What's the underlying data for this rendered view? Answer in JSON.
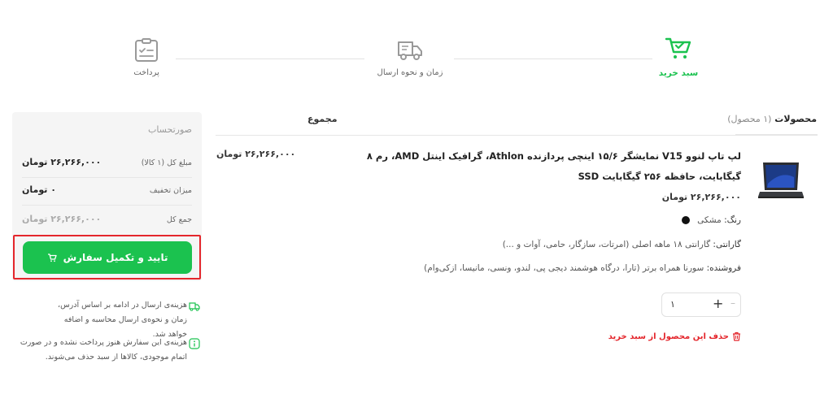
{
  "stepper": {
    "steps": [
      {
        "label": "سبد خرید",
        "icon": "cart-check-icon",
        "active": true
      },
      {
        "label": "زمان و نحوه ارسال",
        "icon": "truck-icon",
        "active": false
      },
      {
        "label": "پرداخت",
        "icon": "clipboard-check-icon",
        "active": false
      }
    ]
  },
  "invoice": {
    "title": "صورتحساب",
    "rows": [
      {
        "label": "مبلغ کل (۱ کالا)",
        "value": "۲۶,۲۶۶,۰۰۰ تومان"
      },
      {
        "label": "میزان تخفیف",
        "value": "۰ تومان"
      },
      {
        "label": "جمع کل",
        "value": "۲۶,۲۶۶,۰۰۰ تومان"
      }
    ],
    "checkout_label": "تایید و تکمیل سفارش"
  },
  "notes": [
    {
      "icon": "truck-icon",
      "text": "هزینه‌ی ارسال در ادامه بر اساس آدرس، زمان و نحوه‌ی ارسال محاسبه و اضافه خواهد شد."
    },
    {
      "icon": "info-icon",
      "text": "هزینه‌ی این سفارش هنوز پرداخت نشده‌ و در صورت اتمام موجودی، کالاها از سبد حذف می‌شوند."
    }
  ],
  "cart": {
    "products_header": "محصولات",
    "products_count": "(۱ محصول)",
    "total_header": "مجموع",
    "item": {
      "title": "لپ تاپ لنوو V15 نمایشگر ۱۵/۶ اینچی پردازنده Athlon، گرافیک اینتل AMD، رم ۸ گیگابایت، حافظه ۲۵۶ گیگابایت SSD",
      "price": "۲۶,۲۶۶,۰۰۰ تومان",
      "line_total": "۲۶,۲۶۶,۰۰۰ تومان",
      "color_label": "رنگ:",
      "color_value": "مشکی",
      "color_hex": "#111111",
      "warranty_label": "گارانتی:",
      "warranty_value": "گارانتی ۱۸ ماهه اصلی (امرتات، سازگار، حامی، آوات و ...)",
      "seller_label": "فروشنده:",
      "seller_value": "سورنا همراه برتر (تارا، درگاه هوشمند دیجی پی، لندو، ونسی، مانیسا، ازکی‌وام)",
      "quantity": "۱",
      "remove_label": "حذف این محصول از سبد خرید"
    }
  },
  "colors": {
    "accent": "#1bc24f",
    "danger": "#e4262c"
  }
}
